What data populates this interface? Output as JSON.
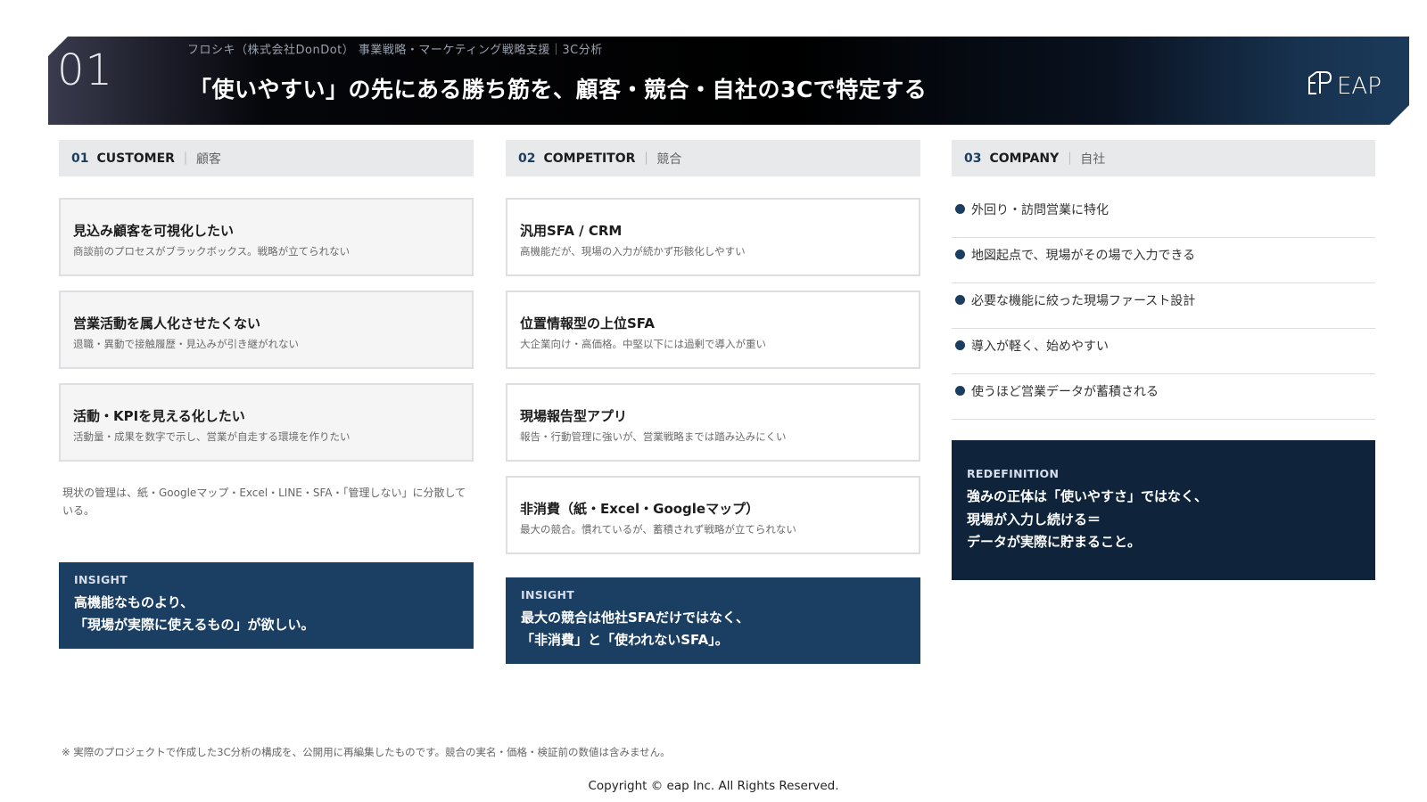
{
  "header": {
    "number": "01",
    "subtitle": "フロシキ（株式会社DonDot） 事業戦略・マーケティング戦略支援｜3C分析",
    "title": "「使いやすい」の先にある勝ち筋を、顧客・競合・自社の3Cで特定する",
    "logo_text": "EAP"
  },
  "columns": [
    {
      "num": "01",
      "en": "CUSTOMER",
      "sep": "｜",
      "ja": "顧客",
      "cards": [
        {
          "title": "見込み顧客を可視化したい",
          "sub": "商談前のプロセスがブラックボックス。戦略が立てられない"
        },
        {
          "title": "営業活動を属人化させたくない",
          "sub": "退職・異動で接触履歴・見込みが引き継がれない"
        },
        {
          "title": "活動・KPIを見える化したい",
          "sub": "活動量・成果を数字で示し、営業が自走する環境を作りたい"
        }
      ],
      "note": "現状の管理は、紙・Googleマップ・Excel・LINE・SFA・「管理しない」に分散している。",
      "insight": {
        "label": "INSIGHT",
        "line1": "高機能なものより、",
        "line2": "「現場が実際に使えるもの」が欲しい。"
      }
    },
    {
      "num": "02",
      "en": "COMPETITOR",
      "sep": "｜",
      "ja": "競合",
      "cards": [
        {
          "title": "汎用SFA / CRM",
          "sub": "高機能だが、現場の入力が続かず形骸化しやすい"
        },
        {
          "title": "位置情報型の上位SFA",
          "sub": "大企業向け・高価格。中堅以下には過剰で導入が重い"
        },
        {
          "title": "現場報告型アプリ",
          "sub": "報告・行動管理に強いが、営業戦略までは踏み込みにくい"
        },
        {
          "title": "非消費（紙・Excel・Googleマップ）",
          "sub": "最大の競合。慣れているが、蓄積されず戦略が立てられない"
        }
      ],
      "insight": {
        "label": "INSIGHT",
        "line1": "最大の競合は他社SFAだけではなく、",
        "line2": "「非消費」と「使われないSFA」。"
      }
    },
    {
      "num": "03",
      "en": "COMPANY",
      "sep": "｜",
      "ja": "自社",
      "features": [
        "外回り・訪問営業に特化",
        "地図起点で、現場がその場で入力できる",
        "必要な機能に絞った現場ファースト設計",
        "導入が軽く、始めやすい",
        "使うほど営業データが蓄積される"
      ],
      "redefinition": {
        "label": "REDEFINITION",
        "line1": "強みの正体は「使いやすさ」ではなく、",
        "line2": "現場が入力し続ける＝",
        "line3": "データが実際に貯まること。"
      }
    }
  ],
  "footnote": "※ 実際のプロジェクトで作成した3C分析の構成を、公開用に再編集したものです。競合の実名・価格・検証前の数値は含みません。",
  "copyright": "Copyright © eap Inc. All Rights Reserved.",
  "colors": {
    "navy": "#1b3f63",
    "dark_navy": "#0f243b",
    "accent": "#1b3d5f"
  }
}
